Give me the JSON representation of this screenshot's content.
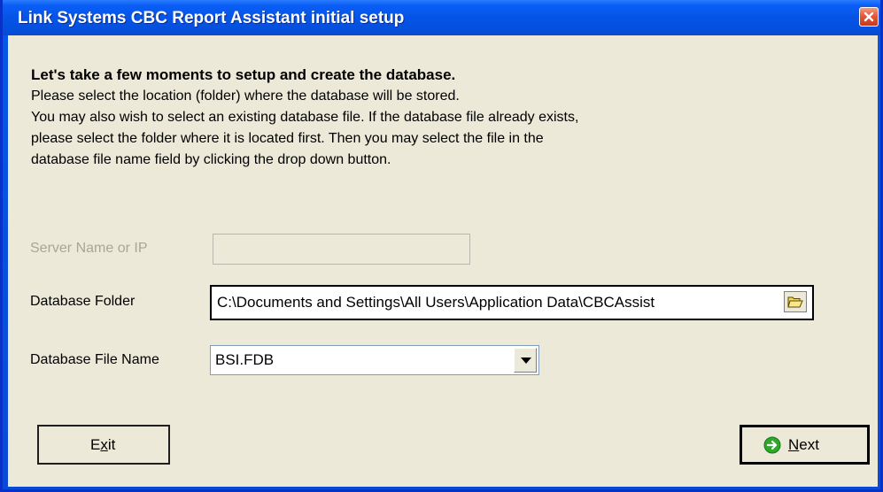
{
  "window": {
    "title": "Link Systems CBC Report Assistant initial setup"
  },
  "intro": {
    "heading": "Let's take a few moments to setup and create the database.",
    "lines": [
      "Please select the location (folder) where the database will be stored.",
      "You may also wish to select an existing database file. If the database file already exists,",
      "please select the folder where it is located first. Then you may select the file in the",
      "database file name field by clicking the drop down button."
    ]
  },
  "form": {
    "server": {
      "label": "Server Name or IP",
      "value": "",
      "disabled": true
    },
    "folder": {
      "label": "Database Folder",
      "value": "C:\\Documents and Settings\\All Users\\Application Data\\CBCAssist"
    },
    "file": {
      "label": "Database File Name",
      "value": "BSI.FDB"
    }
  },
  "buttons": {
    "exit": {
      "label": "Exit",
      "access_key": "x"
    },
    "next": {
      "label": "Next",
      "access_key": "N"
    }
  },
  "icons": {
    "close": "close-icon",
    "folder": "folder-browse-icon",
    "dropdown": "chevron-down-icon",
    "next": "arrow-right-circle-icon"
  },
  "colors": {
    "titlebar": "#0a5ef6",
    "client_bg": "#ece9d8",
    "disabled_text": "#a7a69a",
    "close_button": "#e5573c",
    "next_icon": "#2fa82a"
  }
}
